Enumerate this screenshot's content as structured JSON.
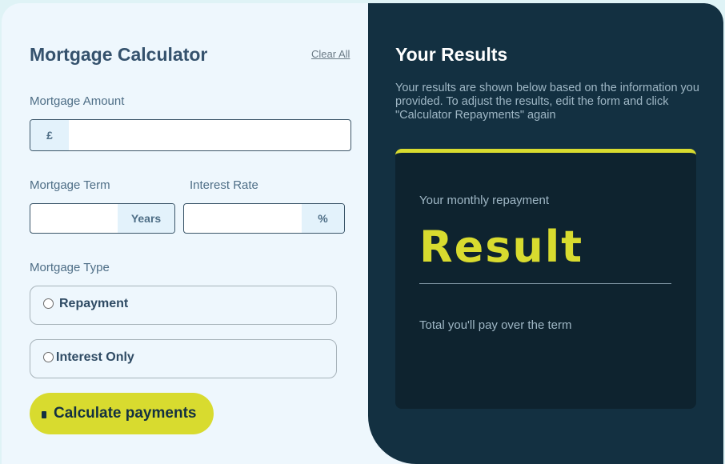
{
  "form": {
    "title": "Mortgage Calculator",
    "clear_label": "Clear All",
    "amount_label": "Mortgage Amount",
    "amount_prefix": "£",
    "amount_value": "",
    "term_label": "Mortgage Term",
    "term_suffix": "Years",
    "term_value": "",
    "rate_label": "Interest Rate",
    "rate_suffix": "%",
    "rate_value": "",
    "type_label": "Mortgage Type",
    "type_options": [
      "Repayment",
      "Interest Only"
    ],
    "submit_label": "Calculate payments"
  },
  "results": {
    "title": "Your Results",
    "description": "Your results are shown below based on the information you provided. To adjust the results, edit the form and click \"Calculator Repayments\" again",
    "monthly_label": "Your monthly repayment",
    "monthly_value": "Result",
    "total_label": "Total you'll pay over the term"
  },
  "colors": {
    "accent": "#d8db2f",
    "dark_panel": "#133041",
    "result_card": "#0e232f",
    "form_bg": "#eef7fd"
  }
}
